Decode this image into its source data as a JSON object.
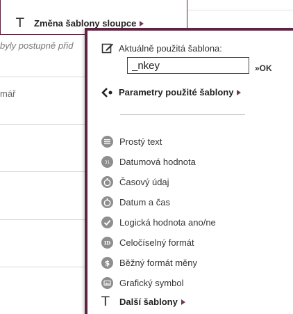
{
  "background": {
    "italic_text": "byly postupně přid",
    "left_label": "mář"
  },
  "previous_popup": {
    "item_label": "Změna šablony sloupce",
    "item_icon": "T-icon"
  },
  "menu": {
    "current_template_label": "Aktuálně použitá šablona:",
    "current_template_value": "_nkey",
    "ok_label": "»OK",
    "params_label": "Parametry použité šablony",
    "types": [
      {
        "label": "Prostý text",
        "icon": "plain-text-icon"
      },
      {
        "label": "Datumová hodnota",
        "icon": "calendar-icon"
      },
      {
        "label": "Časový údaj",
        "icon": "stopwatch-icon"
      },
      {
        "label": "Datum a čas",
        "icon": "stopwatch-icon"
      },
      {
        "label": "Logická hodnota ano/ne",
        "icon": "checkmark-icon"
      },
      {
        "label": "Celočíselný formát",
        "icon": "integer-icon"
      },
      {
        "label": "Běžný formát měny",
        "icon": "currency-icon"
      },
      {
        "label": "Grafický symbol",
        "icon": "image-icon"
      }
    ],
    "more_label": "Další šablony"
  },
  "colors": {
    "accent": "#5e2440",
    "arrow": "#6c3a59",
    "icon_gray": "#8e8e8e"
  }
}
